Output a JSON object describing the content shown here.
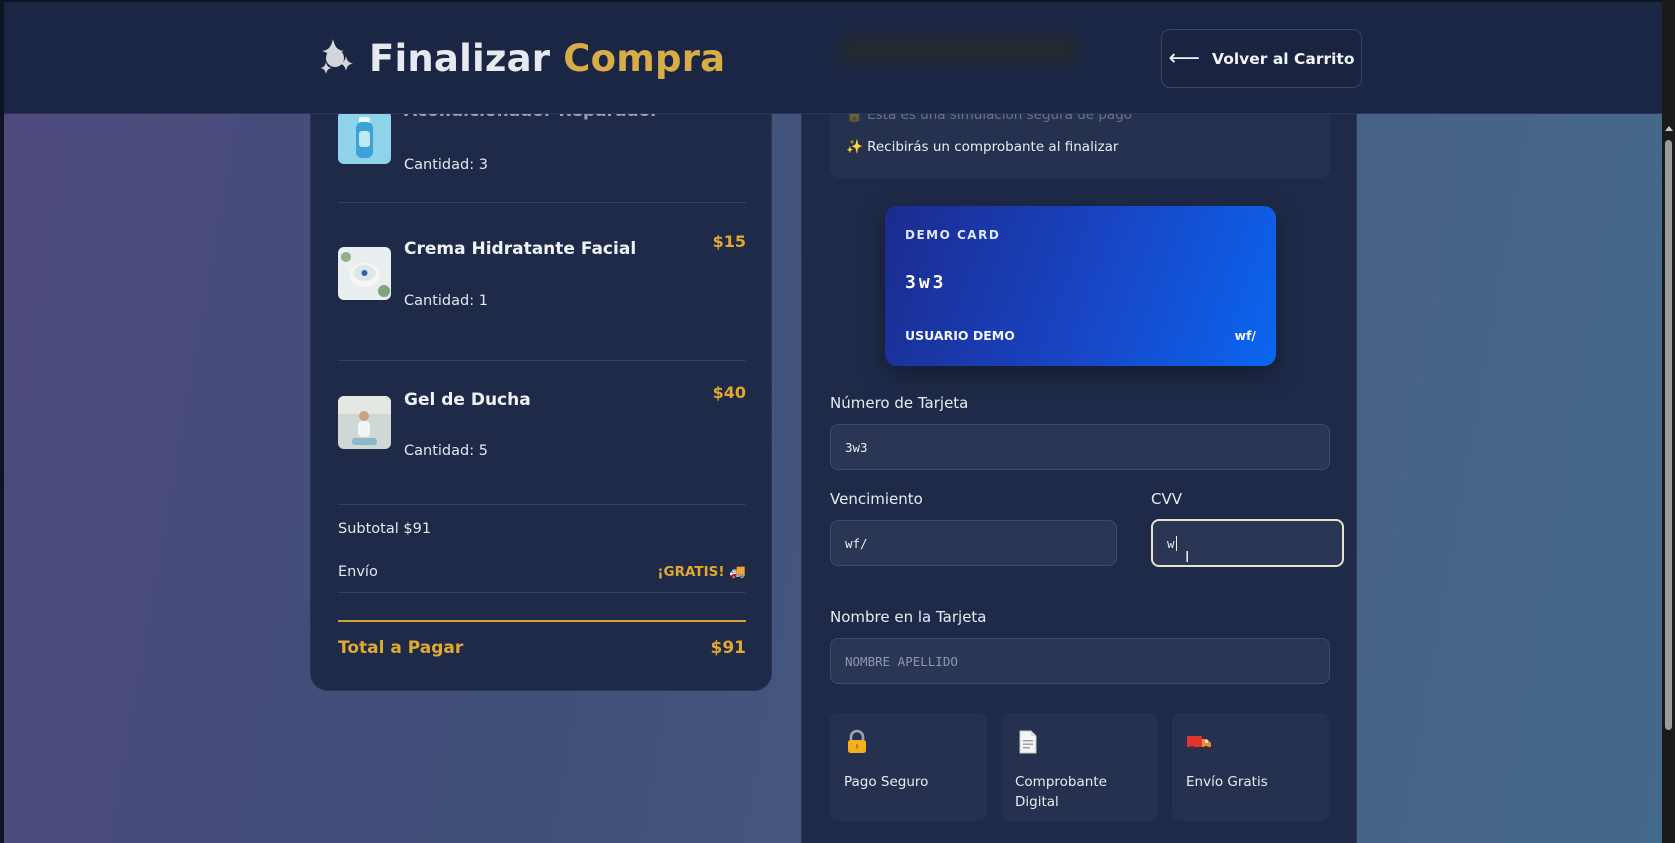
{
  "header": {
    "title_part1": "Finalizar",
    "title_part2": "Compra",
    "back_button": "Volver al Carrito",
    "back_arrow": "⟵"
  },
  "summary": {
    "items": [
      {
        "name": "Acondicionador Reparador",
        "quantity": "Cantidad: 3",
        "price": ""
      },
      {
        "name": "Crema Hidratante Facial",
        "quantity": "Cantidad: 1",
        "price": "$15"
      },
      {
        "name": "Gel de Ducha",
        "quantity": "Cantidad: 5",
        "price": "$40"
      }
    ],
    "subtotal": "Subtotal $91",
    "shipping_label": "Envío",
    "shipping_value": "¡GRATIS! 🚚",
    "total_label": "Total a Pagar",
    "total_value": "$91"
  },
  "payment": {
    "notice_line1": "🔒 Esta es una simulación segura de pago",
    "notice_line2": "✨ Recibirás un comprobante al finalizar",
    "card": {
      "label": "DEMO CARD",
      "number": "3w3",
      "holder": "USUARIO DEMO",
      "expiry": "wf/"
    },
    "fields": {
      "card_number_label": "Número de Tarjeta",
      "card_number_value": "3w3",
      "expiry_label": "Vencimiento",
      "expiry_value": "wf/",
      "cvv_label": "CVV",
      "cvv_value": "w",
      "name_label": "Nombre en la Tarjeta",
      "name_placeholder": "NOMBRE APELLIDO"
    },
    "features": [
      {
        "icon": "lock-icon",
        "label": "Pago Seguro"
      },
      {
        "icon": "document-icon",
        "label": "Comprobante Digital"
      },
      {
        "icon": "truck-icon",
        "label": "Envío Gratis"
      }
    ]
  },
  "colors": {
    "accent_gold": "#d8ac47",
    "panel_bg": "#1e2a48",
    "card_gradient_start": "#1b2b8e",
    "card_gradient_end": "#0a66f0"
  }
}
